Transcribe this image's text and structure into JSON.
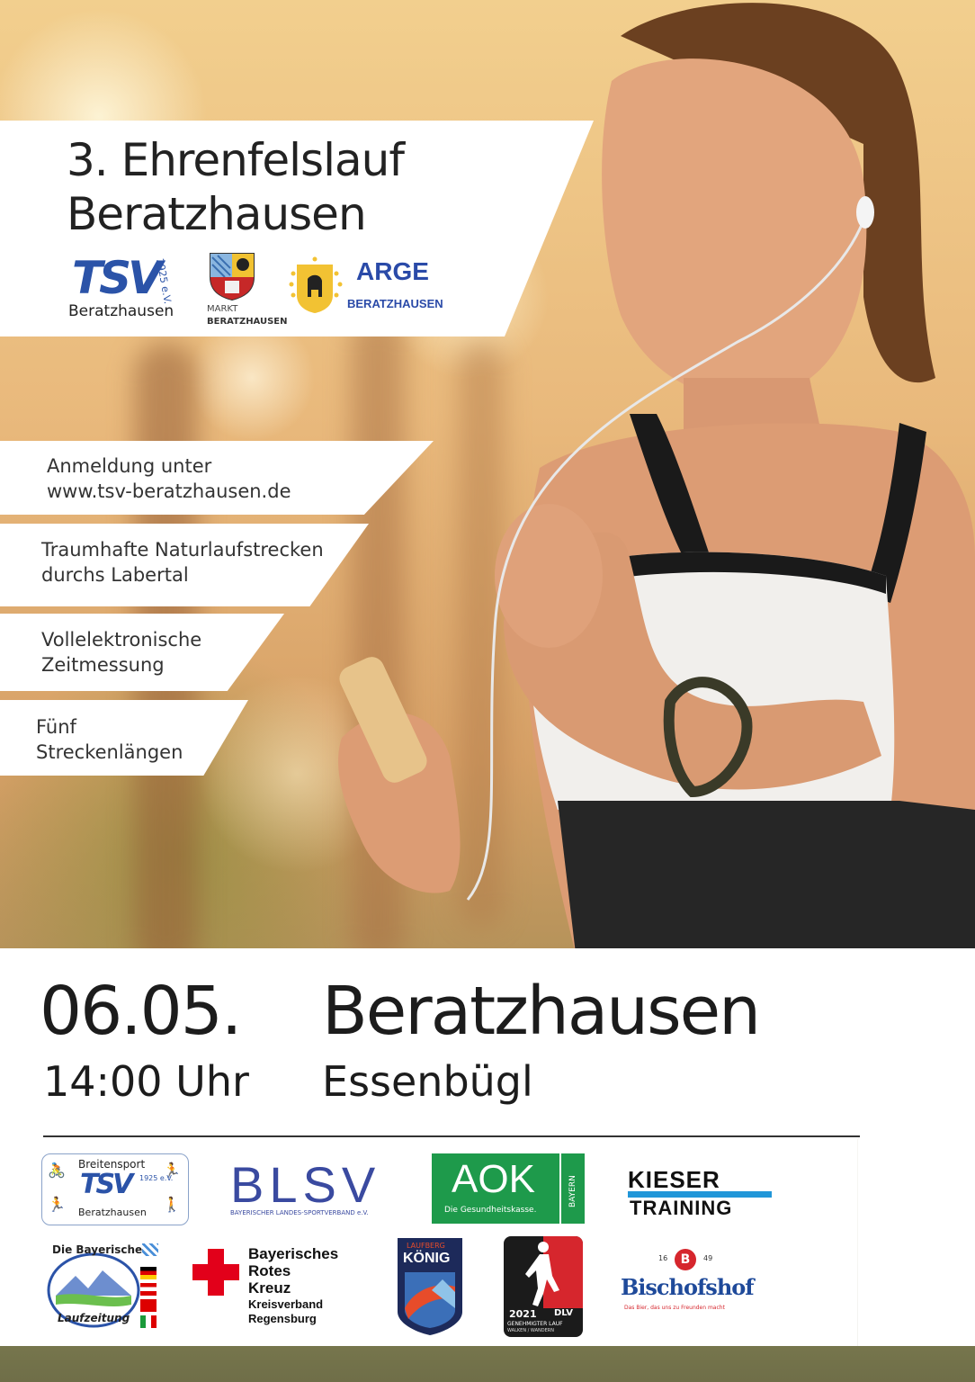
{
  "event": {
    "title_line1": "3. Ehrenfelslauf",
    "title_line2": "Beratzhausen"
  },
  "organizers": {
    "tsv_name": "Beratzhausen",
    "tsv_letters": "TSV",
    "tsv_year": "1925 e.V.",
    "markt_line1": "MARKT",
    "markt_line2": "BERATZHAUSEN",
    "arge_title": "ARGE",
    "arge_sub": "BERATZHAUSEN"
  },
  "features": [
    {
      "line1": "Anmeldung unter",
      "line2": "www.tsv-beratzhausen.de"
    },
    {
      "line1": "Traumhafte Naturlaufstrecken",
      "line2": "durchs Labertal"
    },
    {
      "line1": "Vollelektronische",
      "line2": "Zeitmessung"
    },
    {
      "line1": "Fünf",
      "line2": "Streckenlängen"
    }
  ],
  "schedule": {
    "date": "06.05.",
    "time": "14:00 Uhr",
    "town": "Beratzhausen",
    "location": "Essenbügl"
  },
  "sponsors": {
    "breitensport": {
      "title": "Breitensport",
      "letters": "TSV",
      "year": "1925 e.V.",
      "name": "Beratzhausen"
    },
    "blsv": {
      "letters": "BLSV",
      "sub": "BAYERISCHER LANDES-SPORTVERBAND e.V."
    },
    "aok": {
      "letters": "AOK",
      "sub": "Die Gesundheitskasse.",
      "side": "BAYERN"
    },
    "kieser": {
      "line1": "KIESER",
      "line2": "TRAINING"
    },
    "laufzeitung": {
      "line1": "Die Bayerische",
      "line2": "Laufzeitung"
    },
    "brk": {
      "line1": "Bayerisches",
      "line2": "Rotes",
      "line3": "Kreuz",
      "line4": "Kreisverband",
      "line5": "Regensburg"
    },
    "laufberg": {
      "top": "LAUFBERG",
      "title": "KÖNIG"
    },
    "dlv": {
      "year": "2021",
      "letters": "DLV",
      "sub1": "GENEHMIGTER LAUF",
      "sub2": "WALKEN / WANDERN"
    },
    "bischofshof": {
      "year_left": "16",
      "year_right": "49",
      "monogram": "B",
      "name": "Bischofshof",
      "slogan": "Das Bier, das uns zu Freunden macht"
    }
  },
  "colors": {
    "aok_green": "#1e9a4b",
    "blsv_blue": "#3a4aa0",
    "kieser_blue": "#2196d8",
    "brk_red": "#e2001a",
    "arge_blue": "#2a4aa8",
    "bischofshof_blue": "#1f4a9a"
  }
}
